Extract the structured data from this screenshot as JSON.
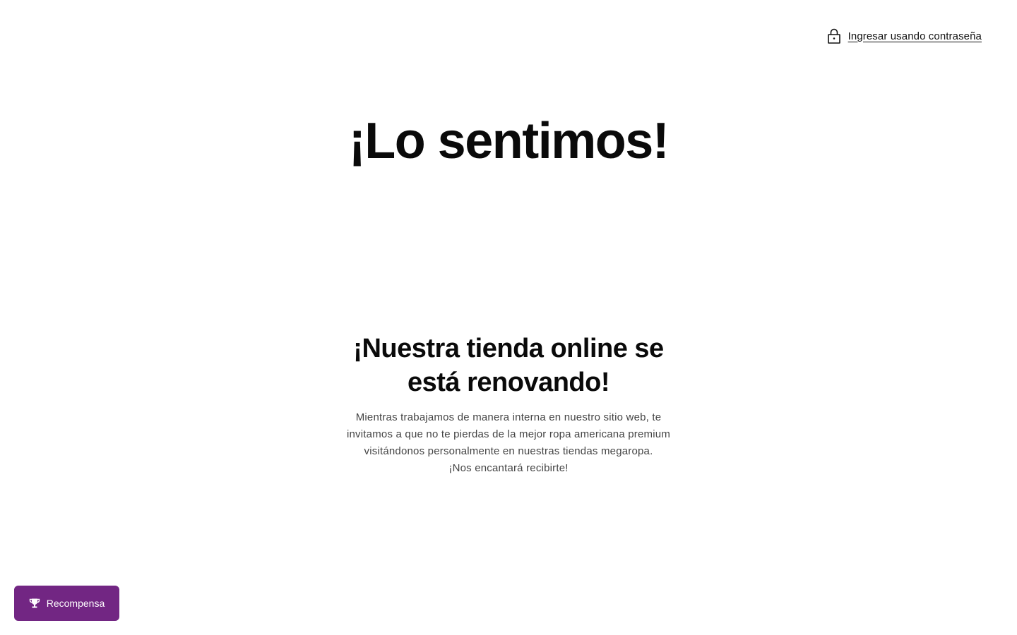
{
  "header": {
    "login_link_label": "Ingresar usando contraseña",
    "login_icon": "lock-icon"
  },
  "hero": {
    "title": "¡Lo sentimos!"
  },
  "main": {
    "subtitle": "¡Nuestra tienda online se está renovando!",
    "message_lines": [
      "Mientras trabajamos de manera interna en nuestro sitio web, te invitamos a que no te pierdas de la mejor ropa americana premium visitándonos personalmente en nuestras tiendas megaropa.",
      "¡Nos encantará recibirte!"
    ]
  },
  "reward": {
    "label": "Recompensa",
    "icon": "trophy-icon",
    "color": "#722683"
  }
}
